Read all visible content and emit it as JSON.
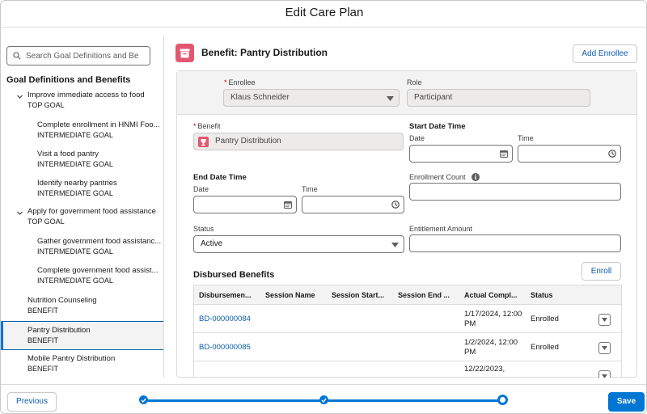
{
  "header": {
    "title": "Edit Care Plan"
  },
  "sidebar": {
    "search_placeholder": "Search Goal Definitions and Be",
    "heading": "Goal Definitions and Benefits",
    "goals": [
      {
        "label": "Improve immediate access to food",
        "type": "TOP GOAL",
        "children": [
          {
            "label": "Complete enrollment in HNMI Foo...",
            "type": "INTERMEDIATE GOAL"
          },
          {
            "label": "Visit a food pantry",
            "type": "INTERMEDIATE GOAL"
          },
          {
            "label": "Identify nearby pantries",
            "type": "INTERMEDIATE GOAL"
          }
        ]
      },
      {
        "label": "Apply for government food assistance",
        "type": "TOP GOAL",
        "children": [
          {
            "label": "Gather government food assistanc...",
            "type": "INTERMEDIATE GOAL"
          },
          {
            "label": "Complete government food assist...",
            "type": "INTERMEDIATE GOAL"
          }
        ]
      }
    ],
    "benefits": [
      {
        "label": "Nutrition Counseling",
        "type": "BENEFIT"
      },
      {
        "label": "Pantry Distribution",
        "type": "BENEFIT",
        "selected": true
      },
      {
        "label": "Mobile Pantry Distribution",
        "type": "BENEFIT"
      }
    ]
  },
  "main": {
    "title": "Benefit: Pantry Distribution",
    "add_enrollee_label": "Add Enrollee",
    "enrollee": {
      "label": "Enrollee",
      "value": "Klaus Schneider"
    },
    "role": {
      "label": "Role",
      "value": "Participant"
    },
    "benefit": {
      "label": "Benefit",
      "value": "Pantry Distribution"
    },
    "start": {
      "heading": "Start Date Time",
      "date_label": "Date",
      "time_label": "Time",
      "date_value": "",
      "time_value": ""
    },
    "end": {
      "heading": "End Date Time",
      "date_label": "Date",
      "time_label": "Time",
      "date_value": "",
      "time_value": ""
    },
    "enrollment_count": {
      "label": "Enrollment Count",
      "value": ""
    },
    "status": {
      "label": "Status",
      "value": "Active"
    },
    "entitlement_amount": {
      "label": "Entitlement Amount",
      "value": ""
    },
    "disbursed": {
      "title": "Disbursed Benefits",
      "enroll_label": "Enroll",
      "columns": [
        "Disbursemen...",
        "Session Name",
        "Session Start...",
        "Session End ...",
        "Actual Compl...",
        "Status"
      ],
      "rows": [
        {
          "id": "BD-000000084",
          "session_name": "",
          "session_start": "",
          "session_end": "",
          "actual_completion": "1/17/2024, 12:00 PM",
          "status": "Enrolled"
        },
        {
          "id": "BD-000000085",
          "session_name": "",
          "session_start": "",
          "session_end": "",
          "actual_completion": "1/2/2024, 12:00 PM",
          "status": "Enrolled"
        },
        {
          "id": "",
          "session_name": "",
          "session_start": "",
          "session_end": "",
          "actual_completion": "12/22/2023,",
          "status": ""
        }
      ]
    }
  },
  "footer": {
    "previous_label": "Previous",
    "save_label": "Save",
    "progress": {
      "steps_total": 3,
      "steps_completed": 2
    }
  },
  "colors": {
    "brand": "#0176d3",
    "benefit_icon": "#e3566f",
    "link": "#0b5cab",
    "required": "#ba0517"
  }
}
